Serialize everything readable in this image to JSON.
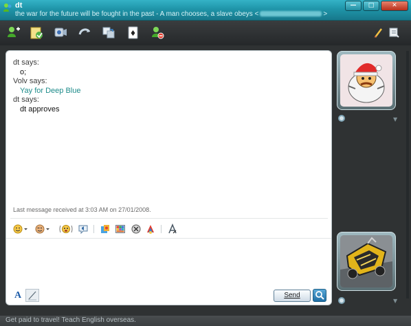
{
  "window": {
    "title": "dt",
    "subtitle": "the war for the future will be fought in the past - A man chooses, a slave obeys <",
    "subtitle_end": ">",
    "accent_color": "#1f95a9",
    "buttons": {
      "minimize": "—",
      "maximize": "□",
      "close": "✕"
    }
  },
  "toolbar": {
    "left_icons": [
      "invite-contact-icon",
      "send-files-icon",
      "webcam-icon",
      "call-icon",
      "share-folders-icon",
      "games-icon",
      "block-icon"
    ],
    "right_icons": [
      "paint-brush-icon",
      "menu-icon"
    ]
  },
  "conversation": {
    "messages": [
      {
        "sender": "dt says:",
        "text": "o;",
        "style": "normal"
      },
      {
        "sender": "Volv says:",
        "text": "Yay for Deep Blue",
        "style": "teal"
      },
      {
        "sender": "dt says:",
        "text": "dt approves",
        "style": "normal"
      }
    ],
    "last_message": "Last message received at 3:03 AM on 27/01/2008."
  },
  "compose": {
    "emoticon_icons": [
      "smiley-icon",
      "wink-icon",
      "nudge-icon",
      "voice-clip-icon",
      "wink-animation-icon",
      "background-icon",
      "handwriting-icon",
      "games-icon",
      "font-icon"
    ],
    "font_label": "A",
    "send_label": "Send",
    "search_icon": "search-icon"
  },
  "status_bar": {
    "text": "Get paid to travel! Teach English overseas."
  }
}
